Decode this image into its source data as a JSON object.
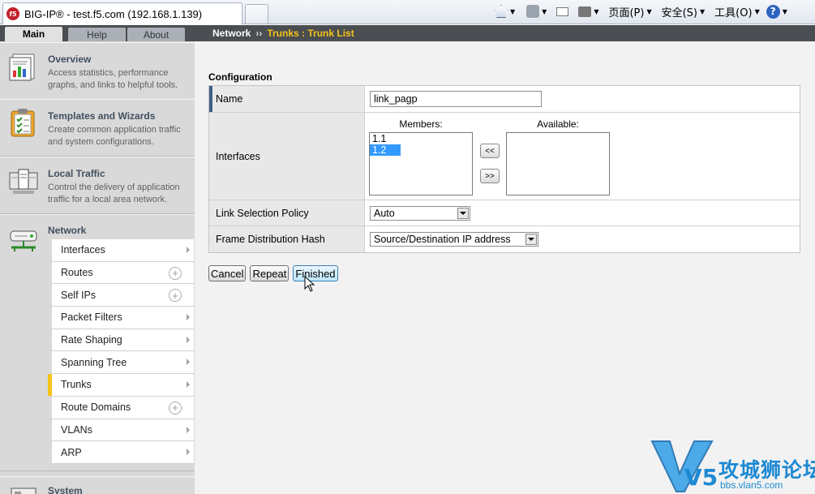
{
  "browser": {
    "tab_title": "BIG-IP® - test.f5.com (192.168.1.139)",
    "favicon_text": "f5",
    "commands": {
      "page_menu": "页面(P)",
      "safety_menu": "安全(S)",
      "tools_menu": "工具(O)",
      "help_glyph": "?"
    }
  },
  "sidebar": {
    "tabs": [
      {
        "label": "Main",
        "active": true
      },
      {
        "label": "Help",
        "active": false
      },
      {
        "label": "About",
        "active": false
      }
    ],
    "sections": [
      {
        "title": "Overview",
        "desc": "Access statistics, performance graphs, and links to helpful tools.",
        "icon": "overview-icon"
      },
      {
        "title": "Templates and Wizards",
        "desc": "Create common application traffic and system configurations.",
        "icon": "clipboard-icon"
      },
      {
        "title": "Local Traffic",
        "desc": "Control the delivery of application traffic for a local area network.",
        "icon": "server-icon"
      },
      {
        "title": "Network",
        "icon": "network-icon"
      },
      {
        "title": "System",
        "icon": "system-icon"
      }
    ],
    "network_items": [
      {
        "label": "Interfaces",
        "kind": "chevron"
      },
      {
        "label": "Routes",
        "kind": "plus"
      },
      {
        "label": "Self IPs",
        "kind": "plus"
      },
      {
        "label": "Packet Filters",
        "kind": "chevron"
      },
      {
        "label": "Rate Shaping",
        "kind": "chevron"
      },
      {
        "label": "Spanning Tree",
        "kind": "chevron"
      },
      {
        "label": "Trunks",
        "kind": "chevron",
        "active": true
      },
      {
        "label": "Route Domains",
        "kind": "plus"
      },
      {
        "label": "VLANs",
        "kind": "chevron"
      },
      {
        "label": "ARP",
        "kind": "chevron"
      }
    ]
  },
  "breadcrumb": {
    "root": "Network",
    "sep": "››",
    "current": "Trunks : Trunk List"
  },
  "config": {
    "title": "Configuration",
    "name_label": "Name",
    "name_value": "link_pagp",
    "interfaces_label": "Interfaces",
    "members_caption": "Members:",
    "available_caption": "Available:",
    "members": [
      {
        "label": "1.1",
        "selected": false
      },
      {
        "label": "1.2",
        "selected": true
      }
    ],
    "available": [],
    "move_left_label": "<<",
    "move_right_label": ">>",
    "link_policy_label": "Link Selection Policy",
    "link_policy_value": "Auto",
    "hash_label": "Frame Distribution Hash",
    "hash_value": "Source/Destination IP address"
  },
  "actions": {
    "cancel": "Cancel",
    "repeat": "Repeat",
    "finished": "Finished"
  },
  "watermark": {
    "mark": "V5",
    "text": "攻城狮论坛",
    "url": "bbs.vlan5.com"
  },
  "colors": {
    "accent_yellow": "#f5c21b",
    "header_dark": "#4a4d51",
    "selection_blue": "#3399ff",
    "watermark_blue": "#1d89d3"
  }
}
